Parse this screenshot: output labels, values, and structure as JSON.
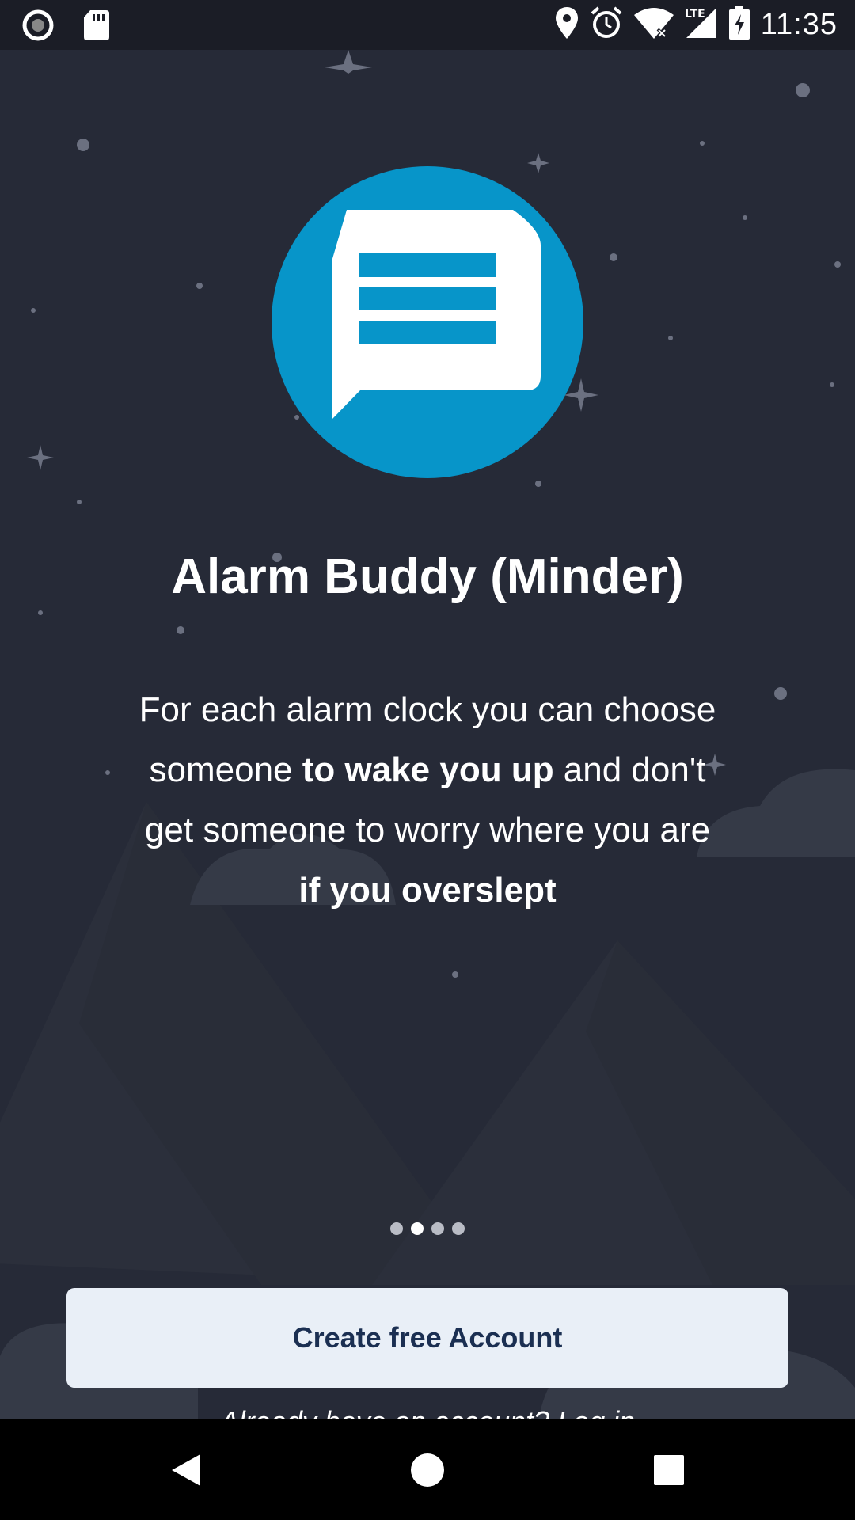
{
  "status_bar": {
    "time": "11:35",
    "network": "LTE",
    "icons": [
      "record-icon",
      "sd-card-icon",
      "location-icon",
      "alarm-icon",
      "wifi-icon",
      "signal-icon",
      "battery-charging-icon"
    ]
  },
  "onboarding": {
    "title": "Alarm Buddy (Minder)",
    "description": {
      "line1": "For each alarm clock you can choose",
      "line2_before": "someone ",
      "line2_bold": "to wake you up",
      "line2_after": " and don't",
      "line3": "get someone to worry where you are",
      "line4_bold": "if you overslept"
    },
    "pager": {
      "total": 4,
      "active_index": 1
    }
  },
  "actions": {
    "create_account_label": "Create free Account",
    "login_prompt": "Already have an account? ",
    "login_link": "Log in"
  },
  "colors": {
    "background": "#262a37",
    "logo_circle": "#0795c9",
    "button_bg": "#e9eff7",
    "button_text": "#1b2f52"
  }
}
